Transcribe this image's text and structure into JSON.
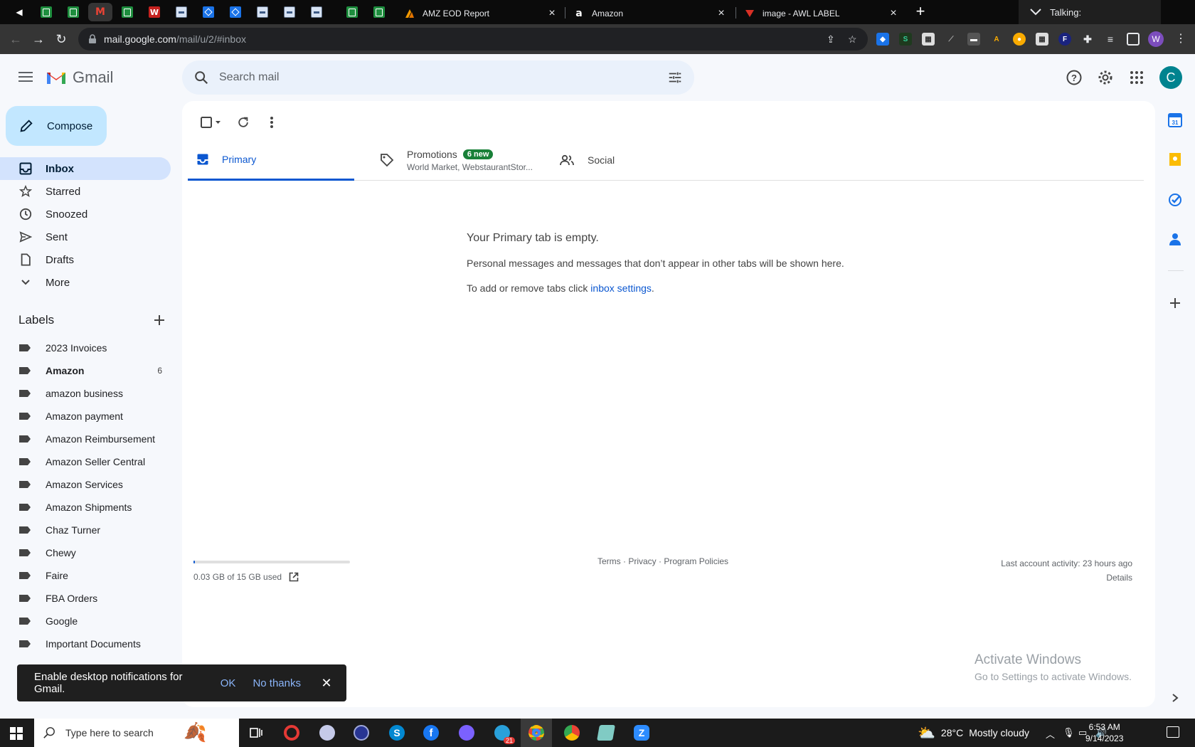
{
  "browser": {
    "tabs": [
      {
        "title": "AMZ EOD Report"
      },
      {
        "title": "Amazon"
      },
      {
        "title": "image - AWL LABEL"
      }
    ],
    "talking_label": "Talking:",
    "url_host": "mail.google.com",
    "url_path": "/mail/u/2/#inbox",
    "profile_initial": "W"
  },
  "header": {
    "app_name": "Gmail",
    "search_placeholder": "Search mail",
    "avatar_initial": "C"
  },
  "sidebar": {
    "compose_label": "Compose",
    "nav": [
      {
        "label": "Inbox",
        "icon": "inbox-icon"
      },
      {
        "label": "Starred",
        "icon": "star-icon"
      },
      {
        "label": "Snoozed",
        "icon": "clock-icon"
      },
      {
        "label": "Sent",
        "icon": "send-icon"
      },
      {
        "label": "Drafts",
        "icon": "draft-icon"
      },
      {
        "label": "More",
        "icon": "chevron-down-icon"
      }
    ],
    "labels_heading": "Labels",
    "labels": [
      {
        "name": "2023 Invoices",
        "count": ""
      },
      {
        "name": "Amazon",
        "count": "6"
      },
      {
        "name": "amazon business",
        "count": ""
      },
      {
        "name": "Amazon payment",
        "count": ""
      },
      {
        "name": "Amazon Reimbursement",
        "count": ""
      },
      {
        "name": "Amazon Seller Central",
        "count": ""
      },
      {
        "name": "Amazon Services",
        "count": ""
      },
      {
        "name": "Amazon Shipments",
        "count": ""
      },
      {
        "name": "Chaz Turner",
        "count": ""
      },
      {
        "name": "Chewy",
        "count": ""
      },
      {
        "name": "Faire",
        "count": ""
      },
      {
        "name": "FBA Orders",
        "count": ""
      },
      {
        "name": "Google",
        "count": ""
      },
      {
        "name": "Important Documents",
        "count": ""
      }
    ]
  },
  "main": {
    "tabs": {
      "primary": "Primary",
      "promotions": "Promotions",
      "promotions_badge": "6 new",
      "promotions_senders": "World Market, WebstaurantStor...",
      "social": "Social"
    },
    "empty_title": "Your Primary tab is empty.",
    "empty_text": "Personal messages and messages that don’t appear in other tabs will be shown here.",
    "empty_text2_prefix": "To add or remove tabs click ",
    "empty_text2_link": "inbox settings",
    "empty_text2_suffix": ".",
    "storage": "0.03 GB of 15 GB used",
    "storage_used_fraction": 0.002,
    "footer_terms": "Terms",
    "footer_privacy": "Privacy",
    "footer_policies": "Program Policies",
    "footer_sep": " · ",
    "last_activity": "Last account activity: 23 hours ago",
    "details": "Details"
  },
  "snackbar": {
    "message": "Enable desktop notifications for Gmail.",
    "ok": "OK",
    "no_thanks": "No thanks"
  },
  "watermark": {
    "line1": "Activate Windows",
    "line2": "Go to Settings to activate Windows."
  },
  "taskbar": {
    "search_placeholder": "Type here to search",
    "weather_temp": "28°C",
    "weather_desc": "Mostly cloudy",
    "time": "6:53 AM",
    "date": "9/14/2023",
    "badge_count": "21"
  },
  "colors": {
    "accent": "#0b57d0",
    "compose_bg": "#c2e7ff",
    "active_nav": "#d3e3fd",
    "badge_green": "#188038"
  }
}
